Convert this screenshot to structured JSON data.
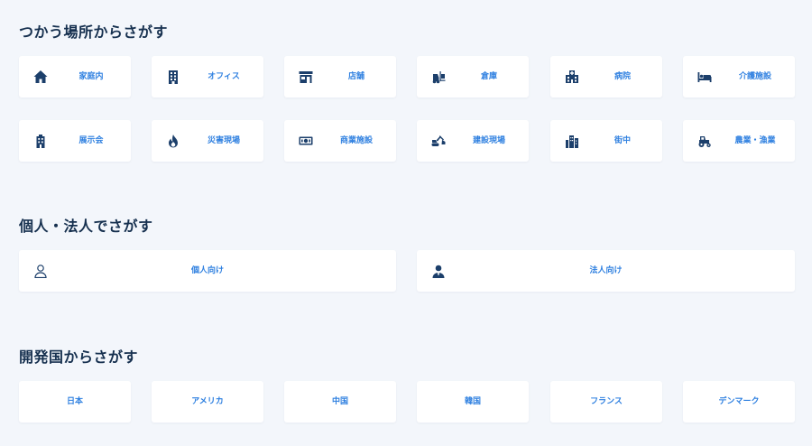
{
  "sections": {
    "place": {
      "title": "つかう場所からさがす",
      "items": [
        {
          "label": "家庭内",
          "icon": "house-icon"
        },
        {
          "label": "オフィス",
          "icon": "office-building-icon"
        },
        {
          "label": "店舗",
          "icon": "storefront-icon"
        },
        {
          "label": "倉庫",
          "icon": "forklift-icon"
        },
        {
          "label": "病院",
          "icon": "hospital-icon"
        },
        {
          "label": "介護施設",
          "icon": "bed-icon"
        },
        {
          "label": "展示会",
          "icon": "exhibition-building-icon"
        },
        {
          "label": "災害現場",
          "icon": "fire-icon"
        },
        {
          "label": "商業施設",
          "icon": "banknote-icon"
        },
        {
          "label": "建設現場",
          "icon": "excavator-icon"
        },
        {
          "label": "街中",
          "icon": "city-icon"
        },
        {
          "label": "農業・漁業",
          "icon": "tractor-icon"
        }
      ]
    },
    "customer": {
      "title": "個人・法人でさがす",
      "items": [
        {
          "label": "個人向け",
          "icon": "person-outline-icon"
        },
        {
          "label": "法人向け",
          "icon": "businessman-icon"
        }
      ]
    },
    "country": {
      "title": "開発国からさがす",
      "items": [
        {
          "label": "日本"
        },
        {
          "label": "アメリカ"
        },
        {
          "label": "中国"
        },
        {
          "label": "韓国"
        },
        {
          "label": "フランス"
        },
        {
          "label": "デンマーク"
        }
      ]
    }
  },
  "colors": {
    "title": "#16304f",
    "label": "#2f80e0",
    "icon": "#1c3f6b",
    "background": "#f3f6fb",
    "card": "#ffffff"
  }
}
